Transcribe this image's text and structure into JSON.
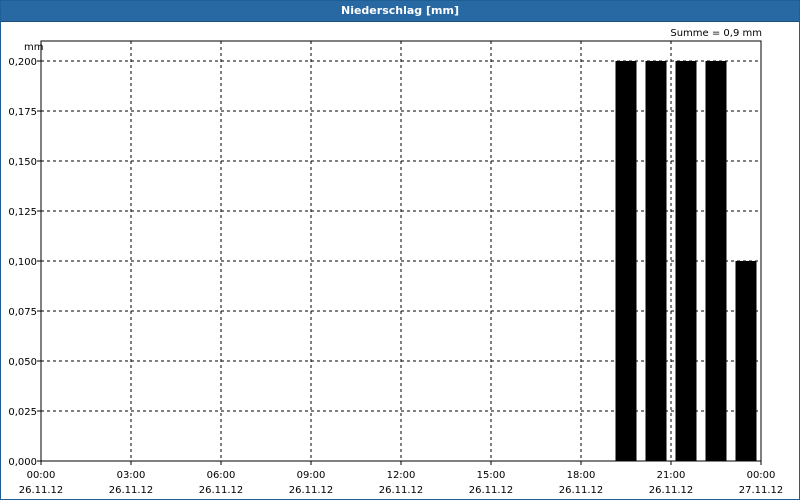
{
  "window": {
    "title": "Niederschlag [mm]"
  },
  "chart_data": {
    "type": "bar",
    "title": "Niederschlag [mm]",
    "ylabel": "mm",
    "annotation": "Summe = 0,9 mm",
    "ylim": [
      0,
      0.2
    ],
    "y_ticks": [
      "0,000",
      "0,025",
      "0,050",
      "0,075",
      "0,100",
      "0,125",
      "0,150",
      "0,175",
      "0,200"
    ],
    "x_ticks": [
      {
        "time": "00:00",
        "date": "26.11.12"
      },
      {
        "time": "03:00",
        "date": "26.11.12"
      },
      {
        "time": "06:00",
        "date": "26.11.12"
      },
      {
        "time": "09:00",
        "date": "26.11.12"
      },
      {
        "time": "12:00",
        "date": "26.11.12"
      },
      {
        "time": "15:00",
        "date": "26.11.12"
      },
      {
        "time": "18:00",
        "date": "26.11.12"
      },
      {
        "time": "21:00",
        "date": "26.11.12"
      },
      {
        "time": "00:00",
        "date": "27.11.12"
      }
    ],
    "x_range": [
      "26.11.12 00:00",
      "27.11.12 00:00"
    ],
    "bars": [
      {
        "time": "26.11.12 19:00",
        "value": 0.2
      },
      {
        "time": "26.11.12 20:00",
        "value": 0.2
      },
      {
        "time": "26.11.12 21:00",
        "value": 0.2
      },
      {
        "time": "26.11.12 22:00",
        "value": 0.2
      },
      {
        "time": "26.11.12 23:00",
        "value": 0.1
      }
    ],
    "grid": true,
    "bar_color": "#000000",
    "grid_color": "#000000"
  },
  "colors": {
    "titlebar": "#2869a4",
    "title_text": "#ffffff"
  }
}
